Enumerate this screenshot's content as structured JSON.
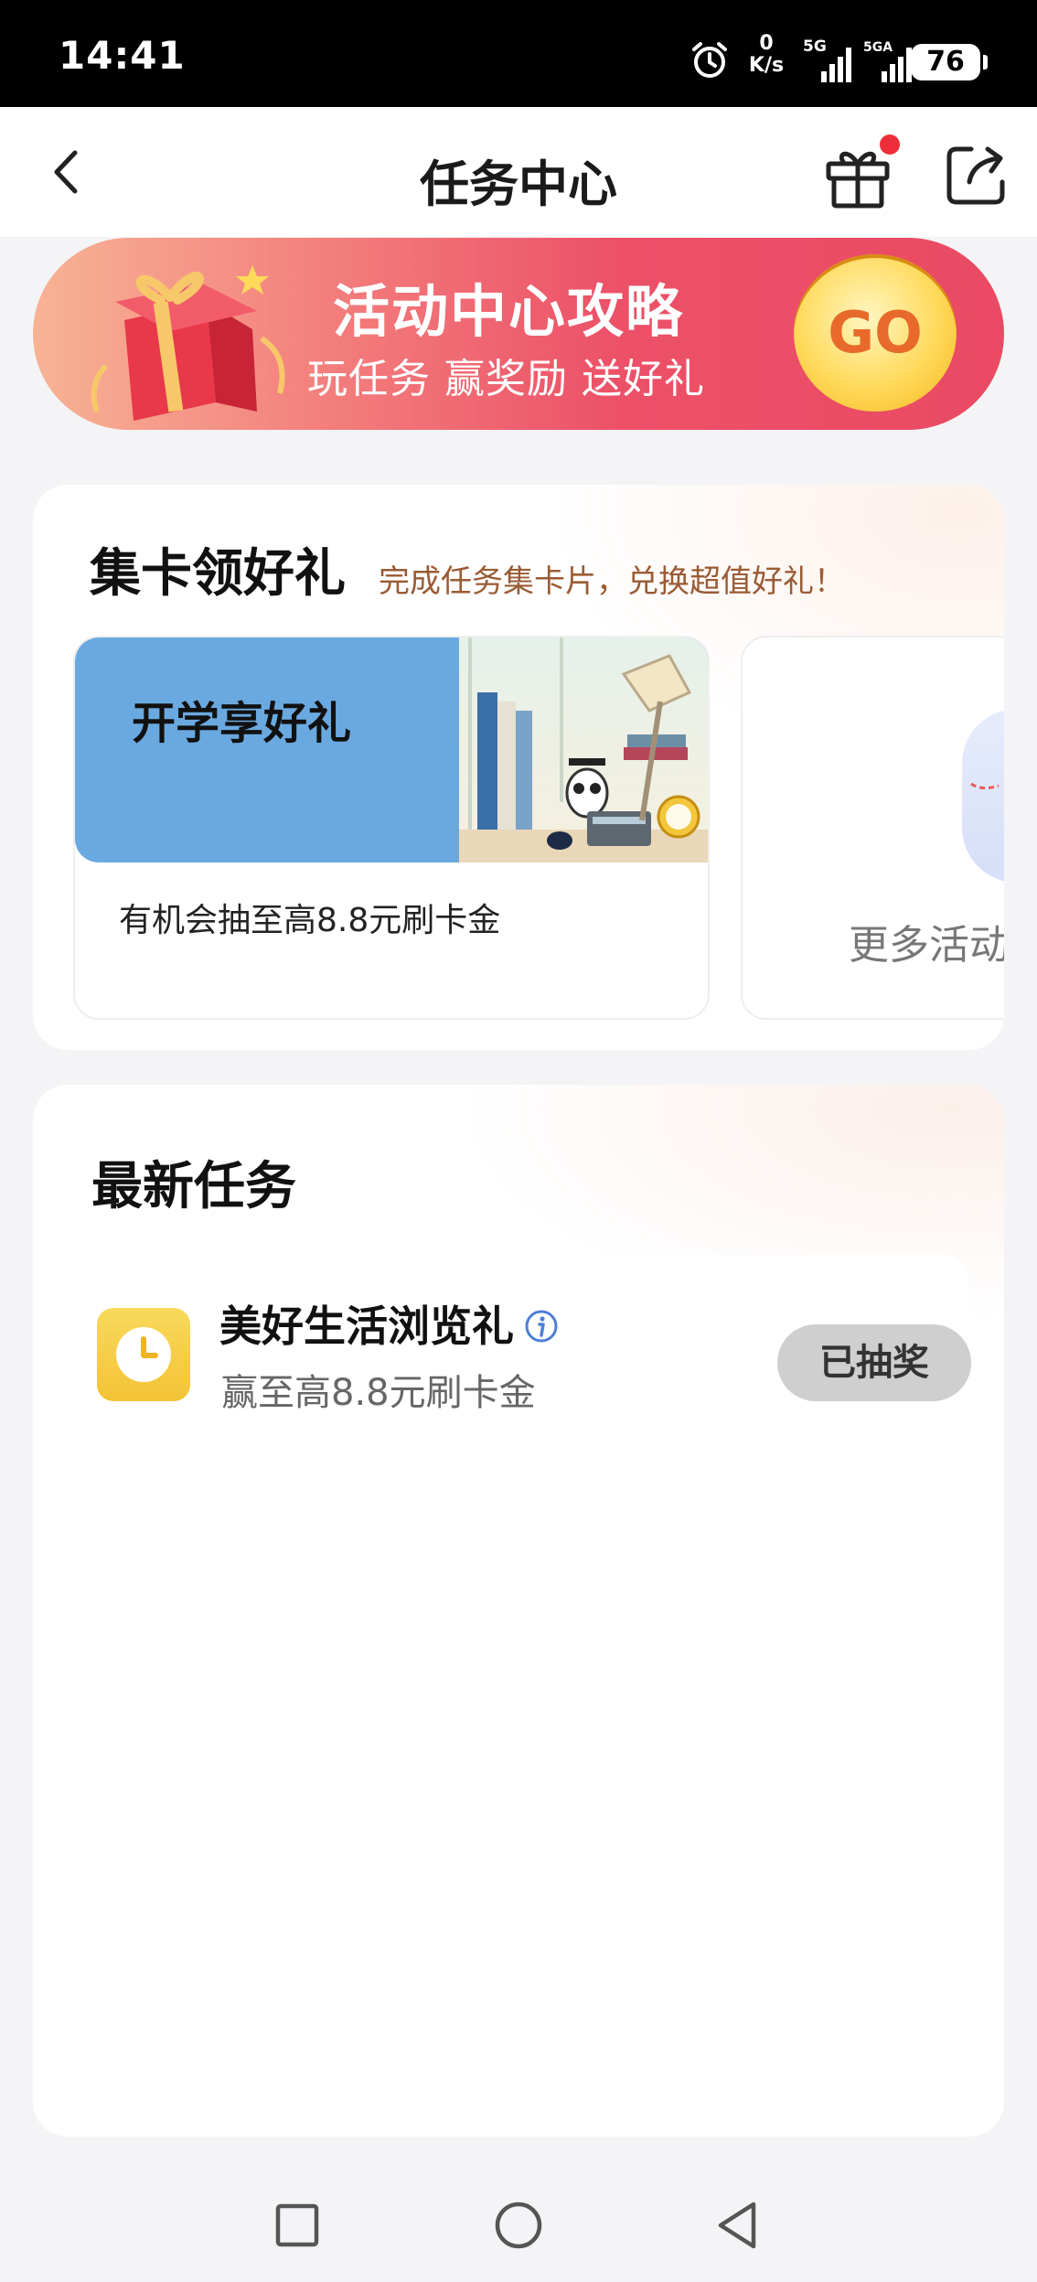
{
  "status_bar": {
    "time": "14:41",
    "net_speed_value": "0",
    "net_speed_unit": "K/s",
    "signal1_label": "5G",
    "signal2_label": "5GA",
    "battery": "76"
  },
  "header": {
    "title": "任务中心"
  },
  "banner": {
    "title": "活动中心攻略",
    "subtitle": "玩任务 赢奖励 送好礼",
    "go_label": "GO"
  },
  "card_section": {
    "title": "集卡领好礼",
    "subtitle": "完成任务集卡片，兑换超值好礼！",
    "cards": [
      {
        "title": "开学享好礼",
        "description": "有机会抽至高8.8元刷卡金"
      }
    ],
    "more_label": "更多活动"
  },
  "task_section": {
    "title": "最新任务",
    "tasks": [
      {
        "name": "美好生活浏览礼",
        "description": "赢至高8.8元刷卡金",
        "status": "已抽奖"
      }
    ]
  },
  "colors": {
    "accent_red": "#ee2f3b",
    "banner_gradient_start": "#f7b394",
    "banner_gradient_end": "#ea4a63",
    "go_yellow": "#ffd95a",
    "card_blue": "#6aa9e0",
    "task_icon_yellow": "#f3c335",
    "button_gray": "#cfcfcf"
  },
  "icons": {
    "back": "chevron-left-icon",
    "gift": "gift-icon",
    "share": "share-icon",
    "alarm": "alarm-icon",
    "info": "info-icon",
    "task": "clock-icon"
  }
}
